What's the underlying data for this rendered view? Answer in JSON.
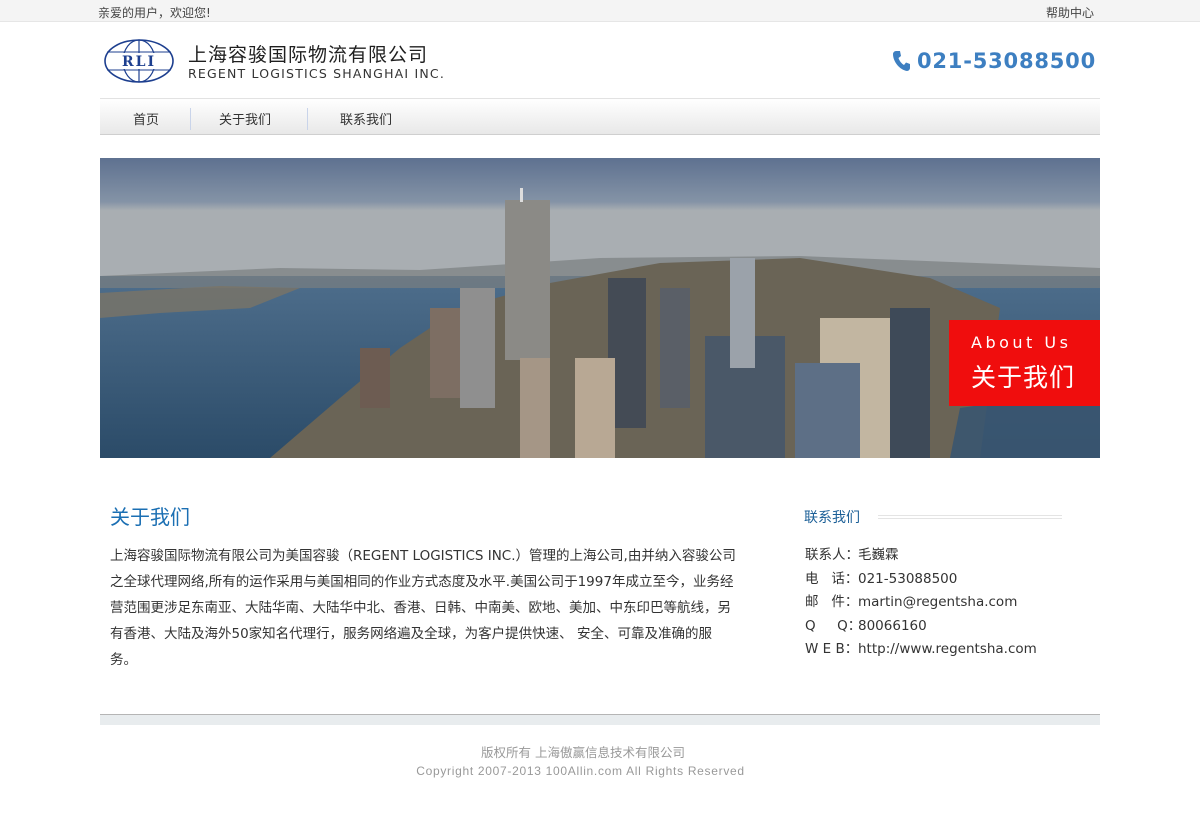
{
  "topbar": {
    "welcome": "亲爱的用户，欢迎您!",
    "help": "帮助中心"
  },
  "header": {
    "logo_text": "RLI",
    "company_cn": "上海容骏国际物流有限公司",
    "company_en": "REGENT LOGISTICS SHANGHAI INC.",
    "phone": "021-53088500",
    "phone_icon": "phone-icon",
    "accent_color": "#3d7fc1"
  },
  "nav": {
    "items": [
      {
        "label": "首页"
      },
      {
        "label": "关于我们"
      },
      {
        "label": "联系我们"
      }
    ]
  },
  "banner": {
    "about_en": "About Us",
    "about_cn": "关于我们",
    "about_color": "#f00d0d"
  },
  "about": {
    "title": "关于我们",
    "body": "上海容骏国际物流有限公司为美国容骏（REGENT LOGISTICS INC.）管理的上海公司,由并纳入容骏公司之全球代理网络,所有的运作采用与美国相同的作业方式态度及水平.美国公司于1997年成立至今，业务经营范围更涉足东南亚、大陆华南、大陆华中北、香港、日韩、中南美、欧地、美加、中东印巴等航线，另有香港、大陆及海外50家知名代理行，服务网络遍及全球，为客户提供快速、 安全、可靠及准确的服务。"
  },
  "contact": {
    "title": "联系我们",
    "rows": [
      {
        "label": "联系人：",
        "value": "毛巍霖"
      },
      {
        "label": "电   话：",
        "value": "021-53088500"
      },
      {
        "label": "邮   件：",
        "value": "martin@regentsha.com"
      },
      {
        "label": "Q     Q：",
        "value": "80066160"
      },
      {
        "label": "W E B：",
        "value": "http://www.regentsha.com"
      }
    ]
  },
  "footer": {
    "copyright_cn": "版权所有 上海傲赢信息技术有限公司",
    "copyright_en": "Copyright 2007-2013 100Allin.com All Rights Reserved"
  }
}
